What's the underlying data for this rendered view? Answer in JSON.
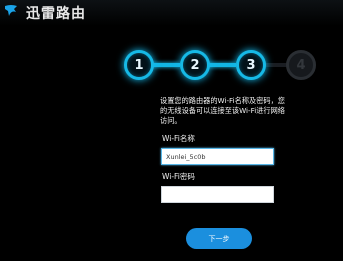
{
  "header": {
    "app_title": "迅雷路由",
    "logo_icon": "thunder-bird-logo-icon"
  },
  "steps": {
    "items": [
      {
        "label": "1",
        "state": "done"
      },
      {
        "label": "2",
        "state": "done"
      },
      {
        "label": "3",
        "state": "current"
      },
      {
        "label": "4",
        "state": "todo"
      }
    ],
    "active_color": "#16b9e6"
  },
  "form": {
    "description": "设置您的路由器的Wi-Fi名称及密码，您的无线设备可以连接至该Wi-Fi进行网络访问。",
    "wifi_name_label": "Wi-Fi名称",
    "wifi_name_value": "Xunlei_5c0b",
    "wifi_password_label": "Wi-Fi密码",
    "wifi_password_value": ""
  },
  "actions": {
    "next_label": "下一步",
    "button_color": "#1b8fde"
  }
}
